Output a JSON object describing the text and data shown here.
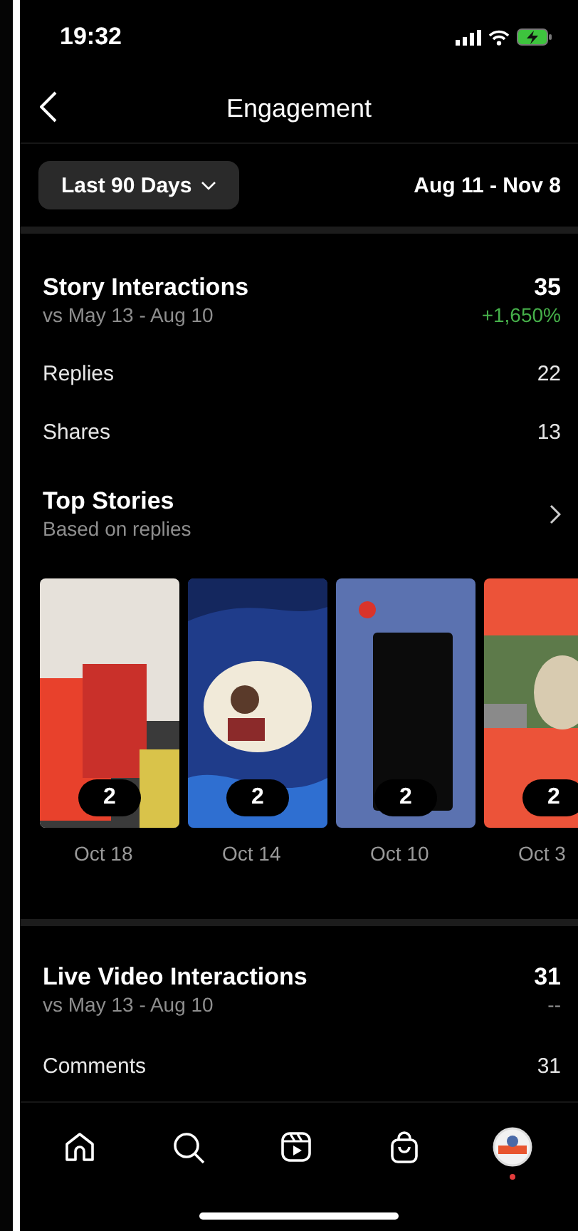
{
  "status_bar": {
    "time": "19:32"
  },
  "header": {
    "title": "Engagement"
  },
  "filter": {
    "range": "Last 90 Days",
    "dates": "Aug 11 - Nov 8"
  },
  "story_interactions": {
    "title": "Story Interactions",
    "compare": "vs May 13 - Aug 10",
    "total": "35",
    "change": "+1,650%",
    "rows": [
      {
        "label": "Replies",
        "value": "22"
      },
      {
        "label": "Shares",
        "value": "13"
      }
    ]
  },
  "top_stories": {
    "title": "Top Stories",
    "subtitle": "Based on replies",
    "items": [
      {
        "kind": "picture",
        "count": "2",
        "date": "Oct 18"
      },
      {
        "kind": "picture",
        "count": "2",
        "date": "Oct 14"
      },
      {
        "kind": "picture",
        "count": "2",
        "date": "Oct 10"
      },
      {
        "kind": "picture",
        "count": "2",
        "date": "Oct 3"
      }
    ]
  },
  "live_interactions": {
    "title": "Live Video Interactions",
    "compare": "vs May 13 - Aug 10",
    "total": "31",
    "change": "--",
    "rows": [
      {
        "label": "Comments",
        "value": "31"
      }
    ]
  },
  "tab_bar": [
    {
      "kind": "home",
      "notification_dot": false
    },
    {
      "kind": "search",
      "notification_dot": false
    },
    {
      "kind": "reels",
      "notification_dot": false
    },
    {
      "kind": "shop",
      "notification_dot": false
    },
    {
      "kind": "profile",
      "notification_dot": true
    }
  ]
}
